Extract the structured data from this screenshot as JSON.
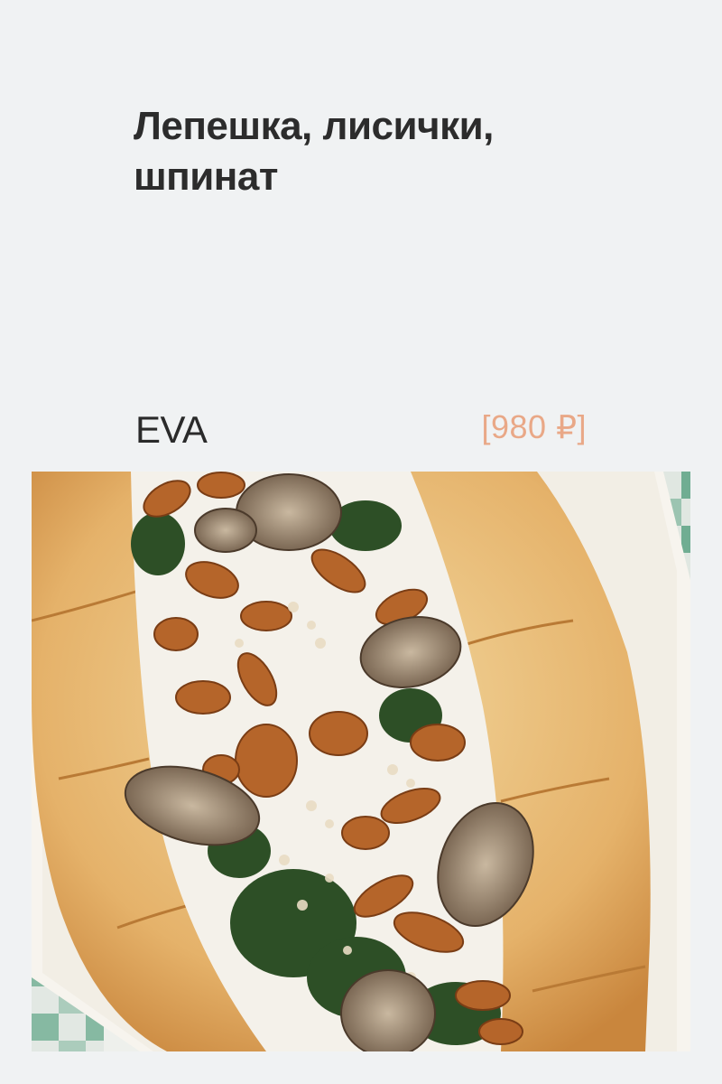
{
  "dish": {
    "title_line1": "Лепешка, лисички,",
    "title_line2": "шпинат",
    "venue": "EVA",
    "price": "[980 ₽]",
    "image_alt": "Лепешка, лисички, шпинат"
  },
  "colors": {
    "background": "#f0f2f3",
    "title": "#2c2c2c",
    "price": "#e9a887"
  }
}
